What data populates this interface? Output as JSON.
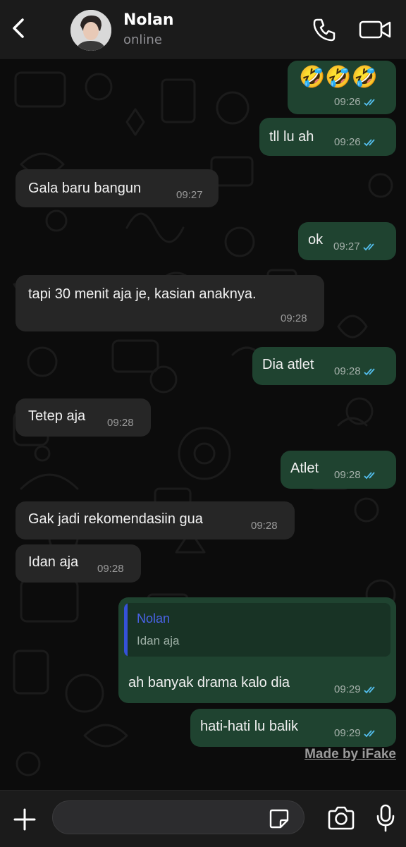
{
  "header": {
    "contact_name": "Nolan",
    "status": "online"
  },
  "messages": [
    {
      "dir": "out",
      "text": "🤣🤣🤣",
      "time": "09:26",
      "read": true
    },
    {
      "dir": "out",
      "text": "tll lu ah",
      "time": "09:26",
      "read": true
    },
    {
      "dir": "in",
      "text": "Gala baru bangun",
      "time": "09:27"
    },
    {
      "dir": "out",
      "text": "ok",
      "time": "09:27",
      "read": true
    },
    {
      "dir": "in",
      "text": "tapi 30 menit aja je, kasian anaknya.",
      "time": "09:28"
    },
    {
      "dir": "out",
      "text": "Dia atlet",
      "time": "09:28",
      "read": true
    },
    {
      "dir": "in",
      "text": "Tetep aja",
      "time": "09:28"
    },
    {
      "dir": "out",
      "text": "Atlet",
      "time": "09:28",
      "read": true
    },
    {
      "dir": "in",
      "text": "Gak jadi rekomendasiin gua",
      "time": "09:28"
    },
    {
      "dir": "in",
      "text": "Idan aja",
      "time": "09:28"
    },
    {
      "dir": "out",
      "text": "ah banyak drama kalo dia",
      "time": "09:29",
      "read": true,
      "quote": {
        "author": "Nolan",
        "text": "Idan aja"
      }
    },
    {
      "dir": "out",
      "text": "hati-hati lu balik",
      "time": "09:29",
      "read": true
    }
  ],
  "watermark": "Made by iFake",
  "input": {
    "placeholder": ""
  },
  "colors": {
    "outgoing_bubble": "#1f4330",
    "incoming_bubble": "#262626",
    "read_ticks": "#53bdeb",
    "quote_accent": "#3551d9"
  },
  "icons": [
    "back-chevron-icon",
    "phone-icon",
    "video-camera-icon",
    "plus-icon",
    "sticker-icon",
    "camera-icon",
    "microphone-icon"
  ]
}
